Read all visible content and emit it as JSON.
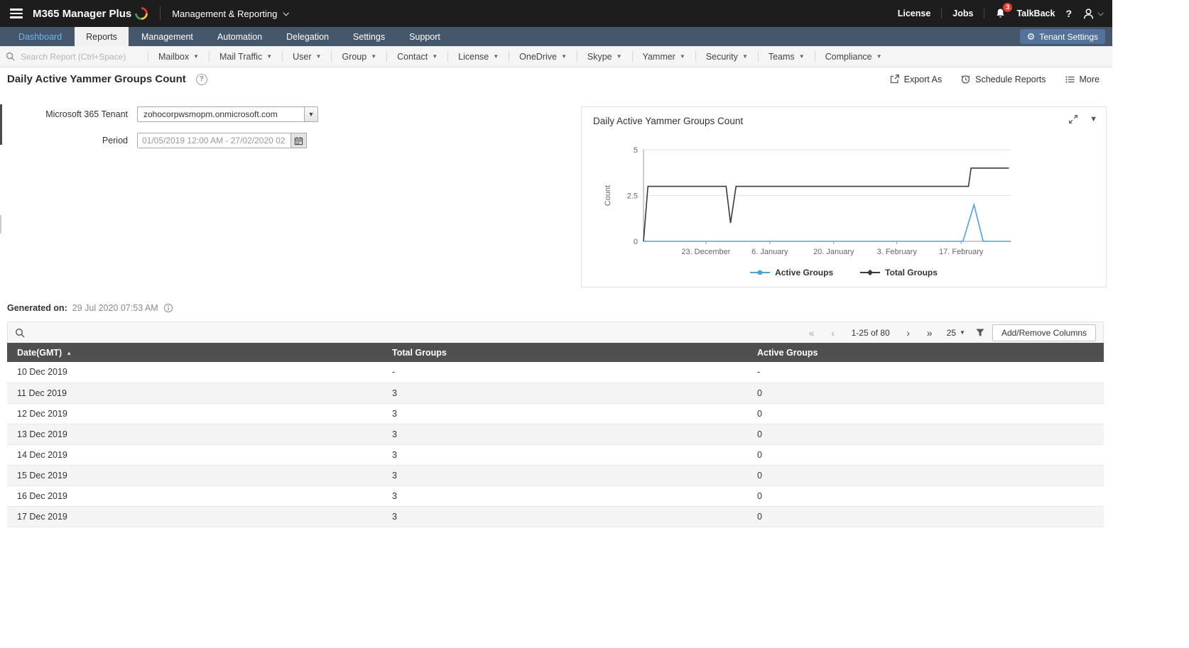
{
  "colors": {
    "topbar_bg": "#1d1d1d",
    "navbar_bg": "#44576b",
    "accent_blue": "#4aa3e0",
    "badge_red": "#e53935",
    "table_header_bg": "#4f4f4f"
  },
  "topbar": {
    "logo": "M365 Manager Plus",
    "context_menu": "Management & Reporting",
    "license": "License",
    "jobs": "Jobs",
    "notification_count": "3",
    "talkback": "TalkBack",
    "help": "?"
  },
  "navbar": {
    "tabs": [
      {
        "label": "Dashboard",
        "active": false,
        "highlight": true
      },
      {
        "label": "Reports",
        "active": true
      },
      {
        "label": "Management"
      },
      {
        "label": "Automation"
      },
      {
        "label": "Delegation"
      },
      {
        "label": "Settings"
      },
      {
        "label": "Support"
      }
    ],
    "tenant_settings": "Tenant Settings"
  },
  "reportmenu": {
    "search_placeholder": "Search Report (Ctrl+Space)",
    "items": [
      "Mailbox",
      "Mail Traffic",
      "User",
      "Group",
      "Contact",
      "License",
      "OneDrive",
      "Skype",
      "Yammer",
      "Security",
      "Teams",
      "Compliance"
    ]
  },
  "page": {
    "title": "Daily Active Yammer Groups Count",
    "help": "?",
    "actions": {
      "export": "Export As",
      "schedule": "Schedule Reports",
      "more": "More"
    }
  },
  "form": {
    "tenant_label": "Microsoft 365 Tenant",
    "tenant_value": "zohocorpwsmopm.onmicrosoft.com",
    "period_label": "Period",
    "period_value": "01/05/2019 12:00 AM - 27/02/2020 02"
  },
  "chart_data": {
    "type": "line",
    "title": "Daily Active Yammer Groups Count",
    "ylabel": "Count",
    "ylim": [
      0,
      5
    ],
    "y_ticks": [
      0,
      2.5,
      5
    ],
    "grid": true,
    "legend_position": "bottom",
    "x_ticks": [
      {
        "label": "23. December",
        "pos": 0.17
      },
      {
        "label": "6. January",
        "pos": 0.344
      },
      {
        "label": "20. January",
        "pos": 0.518
      },
      {
        "label": "3. February",
        "pos": 0.69
      },
      {
        "label": "17. February",
        "pos": 0.865
      }
    ],
    "series": [
      {
        "name": "Active Groups",
        "color": "#4aa3e0",
        "marker": "circle",
        "points": [
          [
            0,
            0
          ],
          [
            0.87,
            0
          ],
          [
            0.9,
            2
          ],
          [
            0.925,
            0
          ],
          [
            1,
            0
          ]
        ]
      },
      {
        "name": "Total Groups",
        "color": "#3a3a3a",
        "marker": "diamond",
        "points": [
          [
            0,
            0
          ],
          [
            0.012,
            3
          ],
          [
            0.225,
            3
          ],
          [
            0.237,
            1
          ],
          [
            0.252,
            3
          ],
          [
            0.885,
            3
          ],
          [
            0.892,
            4
          ],
          [
            0.995,
            4
          ]
        ]
      }
    ]
  },
  "generated": {
    "label": "Generated on:",
    "value": "29 Jul 2020 07:53 AM"
  },
  "toolbar": {
    "range": "1-25 of 80",
    "page_size": "25",
    "add_remove": "Add/Remove Columns"
  },
  "table": {
    "columns": [
      "Date(GMT)",
      "Total Groups",
      "Active Groups"
    ],
    "rows": [
      [
        "10 Dec 2019",
        "-",
        "-"
      ],
      [
        "11 Dec 2019",
        "3",
        "0"
      ],
      [
        "12 Dec 2019",
        "3",
        "0"
      ],
      [
        "13 Dec 2019",
        "3",
        "0"
      ],
      [
        "14 Dec 2019",
        "3",
        "0"
      ],
      [
        "15 Dec 2019",
        "3",
        "0"
      ],
      [
        "16 Dec 2019",
        "3",
        "0"
      ],
      [
        "17 Dec 2019",
        "3",
        "0"
      ]
    ]
  }
}
